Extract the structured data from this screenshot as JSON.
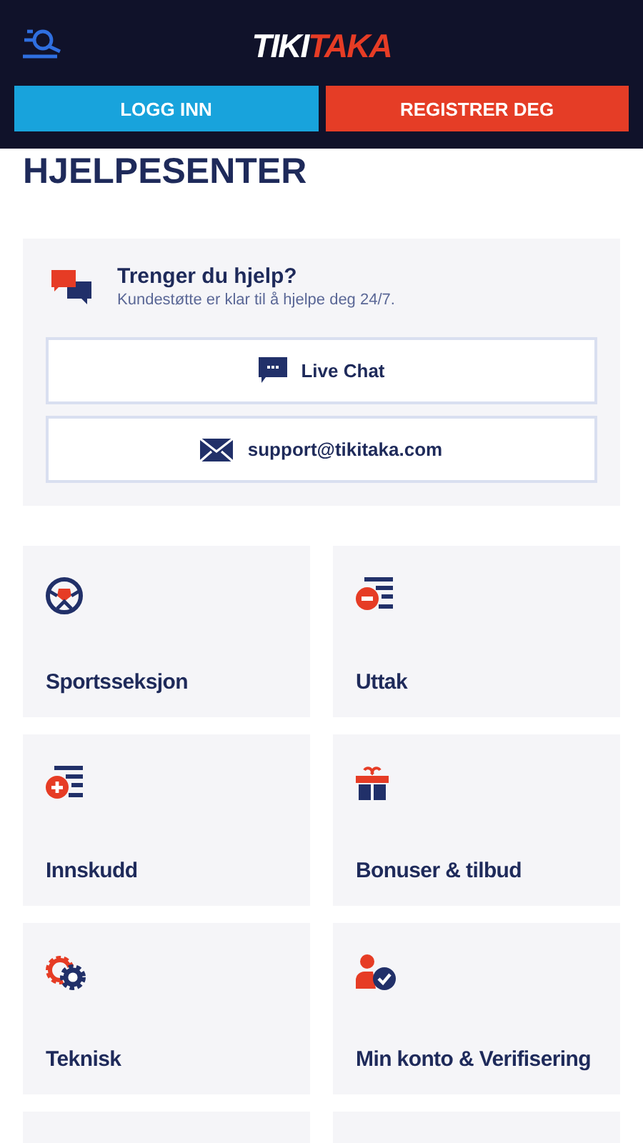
{
  "header": {
    "logo": {
      "first": "TIKI",
      "second": "TAKA"
    },
    "buttons": [
      {
        "label": "LOGG INN",
        "kind": "login"
      },
      {
        "label": "REGISTRER DEG",
        "kind": "register"
      }
    ]
  },
  "title": "HJELPESENTER",
  "help": {
    "heading": "Trenger du hjelp?",
    "subtitle": "Kundestøtte er klar til å hjelpe deg 24/7.",
    "actions": [
      {
        "label": "Live Chat",
        "kind": "chat"
      },
      {
        "label": "support@tikitaka.com",
        "kind": "email"
      }
    ]
  },
  "categories": [
    {
      "label": "Sportsseksjon",
      "kind": "ball"
    },
    {
      "label": "Uttak",
      "kind": "withdraw"
    },
    {
      "label": "Innskudd",
      "kind": "deposit"
    },
    {
      "label": "Bonuser & tilbud",
      "kind": "gift"
    },
    {
      "label": "Teknisk",
      "kind": "gears"
    },
    {
      "label": "Min konto & Verifisering",
      "kind": "account"
    },
    {
      "kind": "cutoff"
    },
    {
      "kind": "cutoff"
    }
  ]
}
